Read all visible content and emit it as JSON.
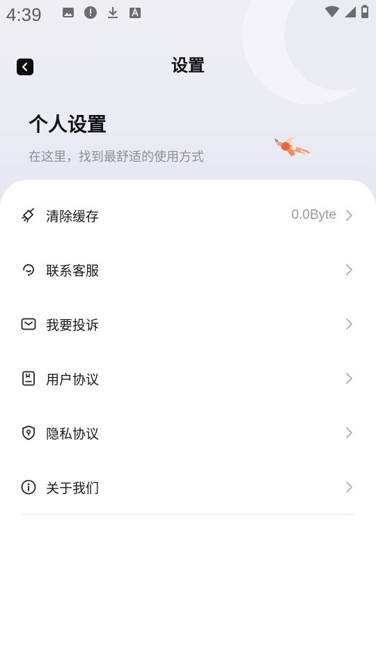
{
  "status_bar": {
    "time": "4:39",
    "left_icons": [
      "image-icon",
      "alert-icon",
      "download-icon",
      "a-box-icon"
    ],
    "right_icons": [
      "wifi-icon",
      "cell-signal-icon",
      "battery-icon"
    ]
  },
  "header": {
    "title": "设置",
    "back_icon": "back-chevron-icon"
  },
  "hero": {
    "title": "个人设置",
    "subtitle": "在这里，找到最舒适的使用方式",
    "illustration": "rocket-illustration"
  },
  "menu": {
    "items": [
      {
        "label": "清除缓存",
        "value": "0.0Byte",
        "icon": "broom-icon"
      },
      {
        "label": "联系客服",
        "value": "",
        "icon": "headset-icon"
      },
      {
        "label": "我要投诉",
        "value": "",
        "icon": "envelope-icon"
      },
      {
        "label": "用户协议",
        "value": "",
        "icon": "document-icon"
      },
      {
        "label": "隐私协议",
        "value": "",
        "icon": "shield-lock-icon"
      },
      {
        "label": "关于我们",
        "value": "",
        "icon": "info-icon"
      }
    ]
  },
  "colors": {
    "accent": "#111111",
    "muted_text": "#8e8e96",
    "header_bg": "#eeeef3"
  }
}
